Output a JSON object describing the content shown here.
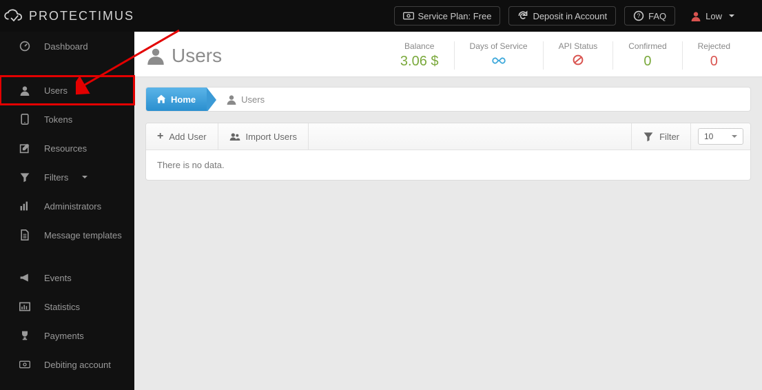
{
  "brand": "PROTECTIMUS",
  "topbar": {
    "service_plan": "Service Plan: Free",
    "deposit": "Deposit in Account",
    "faq": "FAQ",
    "security_level": "Low"
  },
  "sidebar": {
    "items": [
      {
        "label": "Dashboard"
      },
      {
        "label": "Users"
      },
      {
        "label": "Tokens"
      },
      {
        "label": "Resources"
      },
      {
        "label": "Filters"
      },
      {
        "label": "Administrators"
      },
      {
        "label": "Message templates"
      },
      {
        "label": "Events"
      },
      {
        "label": "Statistics"
      },
      {
        "label": "Payments"
      },
      {
        "label": "Debiting account"
      }
    ],
    "active_index": 1
  },
  "page": {
    "title": "Users",
    "metrics": [
      {
        "label": "Balance",
        "value": "3.06 $",
        "cls": "green"
      },
      {
        "label": "Days of Service",
        "value": "∞",
        "cls": "blue",
        "icon": "infinity"
      },
      {
        "label": "API Status",
        "value": "⊘",
        "cls": "redv",
        "icon": "ban"
      },
      {
        "label": "Confirmed",
        "value": "0",
        "cls": "green"
      },
      {
        "label": "Rejected",
        "value": "0",
        "cls": "redv"
      }
    ]
  },
  "breadcrumb": {
    "home": "Home",
    "current": "Users"
  },
  "toolbar": {
    "add_user": "Add User",
    "import_users": "Import Users",
    "filter": "Filter",
    "page_size": "10"
  },
  "table": {
    "empty_text": "There is no data."
  }
}
